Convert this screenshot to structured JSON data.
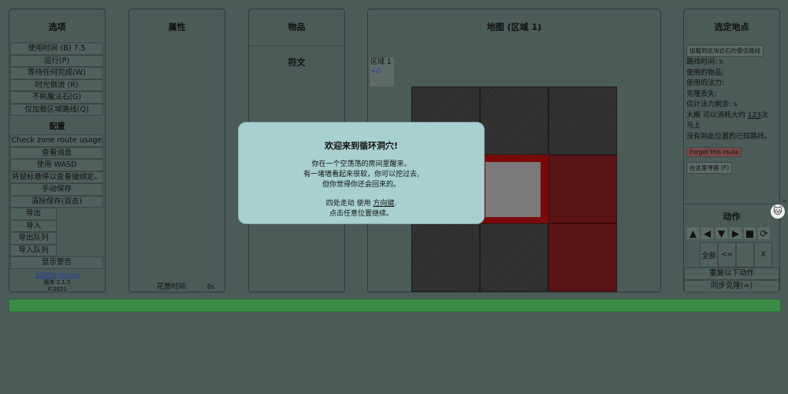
{
  "options": {
    "title": "选项",
    "buttons": [
      "使用时间 (B) 7.5",
      "运行(P)",
      "等待任何完成(W)",
      "时光倒流 (R)",
      "不刷魔法石(G)",
      "仅加载区域路线(Q)"
    ],
    "config_title": "配置",
    "config_buttons": [
      "Check zone route usage",
      "查看消息",
      "使用 WASD",
      "将鼠标悬停以查看键绑定。",
      "手动保存",
      "清除保存(双击)"
    ],
    "half_buttons": [
      "导出",
      "导入",
      "导出队列",
      "导入队列"
    ],
    "warn_button": "显示警告",
    "support": "支持开发",
    "discord": "Discord",
    "version": "版本 2.1.5",
    "year": "©2021"
  },
  "attributes": {
    "title": "属性",
    "time_label": "花费时间:",
    "time_value": "0s"
  },
  "items": {
    "title": "物品",
    "runes_title": "符文"
  },
  "map": {
    "title": "地图 (区域 1)",
    "region_label": "区域 1",
    "region_value": "+0"
  },
  "location": {
    "title": "选定地点",
    "load_route_button": "加载到这块岩石的最佳路线",
    "route_time": "路线时间:   s",
    "used_items": "使用的物品:",
    "used_mana": "使用的法力:",
    "lost": "克隆丢失:",
    "mana_left": "估计法力剩余:   s",
    "approx_prefix": "大概 可以消耗大约 ",
    "approx_value": "123",
    "approx_suffix": "次",
    "horse": "马上",
    "no_route": "没有到此位置的已知路线。",
    "forget_button": "Forget this route",
    "find_path_button": "在这里寻路 (F)"
  },
  "actions": {
    "title": "动作",
    "icons": [
      "▲",
      "◀",
      "▼",
      "▶",
      "■",
      "⟳"
    ],
    "cells": [
      "全部",
      "<=",
      "",
      "X"
    ],
    "repeat": "重复以下动作",
    "sync": "同步克隆(=)"
  },
  "welcome": {
    "title": "欢迎来到循环洞穴!",
    "line1": "你在一个空荡荡的房间里醒来。",
    "line2": "有一堵墙看起来很软，你可以挖过去,",
    "line3": "但你觉得你还会回来的。",
    "move_prefix": "四处走动 使用 ",
    "move_key": "方向键",
    "move_suffix": ".",
    "continue": "点击任意位置继续。"
  },
  "colors": {
    "bg": "#4a5b58",
    "progress": "#3c8b45",
    "dialog": "#a8d0d0",
    "wall_red": "#5a1416"
  }
}
